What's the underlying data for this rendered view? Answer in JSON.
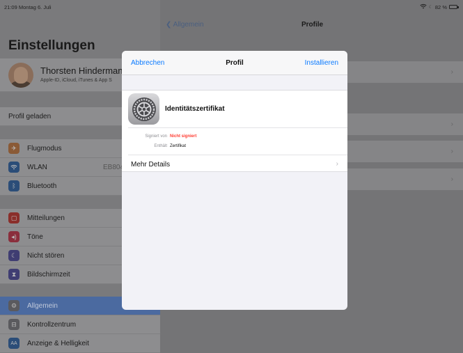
{
  "status_bar": {
    "time": "21:09",
    "date": "Montag 6. Juli",
    "battery": "82 %",
    "battery_level": 0.82
  },
  "sidebar": {
    "title": "Einstellungen",
    "profile": {
      "name": "Thorsten Hinderman",
      "subtitle": "Apple-ID, iCloud, iTunes & App S"
    },
    "profile_loaded": "Profil geladen",
    "items": [
      {
        "label": "Flugmodus",
        "icon": "airplane-icon",
        "color": "#8a5a36",
        "value": ""
      },
      {
        "label": "WLAN",
        "icon": "wifi-icon",
        "color": "#2b4d78",
        "value": "EB804"
      },
      {
        "label": "Bluetooth",
        "icon": "bluetooth-icon",
        "color": "#2b4d78",
        "value": ""
      },
      {
        "label": "Mitteilungen",
        "icon": "notifications-icon",
        "color": "#8a2e2a",
        "value": ""
      },
      {
        "label": "Töne",
        "icon": "sound-icon",
        "color": "#8a2e3c",
        "value": ""
      },
      {
        "label": "Nicht stören",
        "icon": "moon-icon",
        "color": "#3f3d72",
        "value": ""
      },
      {
        "label": "Bildschirmzeit",
        "icon": "hourglass-icon",
        "color": "#3f3d72",
        "value": ""
      },
      {
        "label": "Allgemein",
        "icon": "gear-icon",
        "color": "#5a5a5e",
        "value": "",
        "selected": true
      },
      {
        "label": "Kontrollzentrum",
        "icon": "switches-icon",
        "color": "#5a5a5e",
        "value": ""
      },
      {
        "label": "Anzeige & Helligkeit",
        "icon": "text-size-icon",
        "color": "#2b4d78",
        "value": ""
      }
    ]
  },
  "detail": {
    "back_label": "Allgemein",
    "title": "Profile"
  },
  "modal": {
    "cancel_label": "Abbrechen",
    "title": "Profil",
    "install_label": "Installieren",
    "certificate_name": "Identitätszertifikat",
    "signed_by_label": "Signiert von",
    "signed_by_value": "Nicht signiert",
    "contains_label": "Enthält",
    "contains_value": "Zertifikat",
    "more_details_label": "Mehr Details"
  },
  "colors": {
    "accent": "#0a7aff",
    "warning": "#ff3b30",
    "selection": "#4b6aa0"
  }
}
